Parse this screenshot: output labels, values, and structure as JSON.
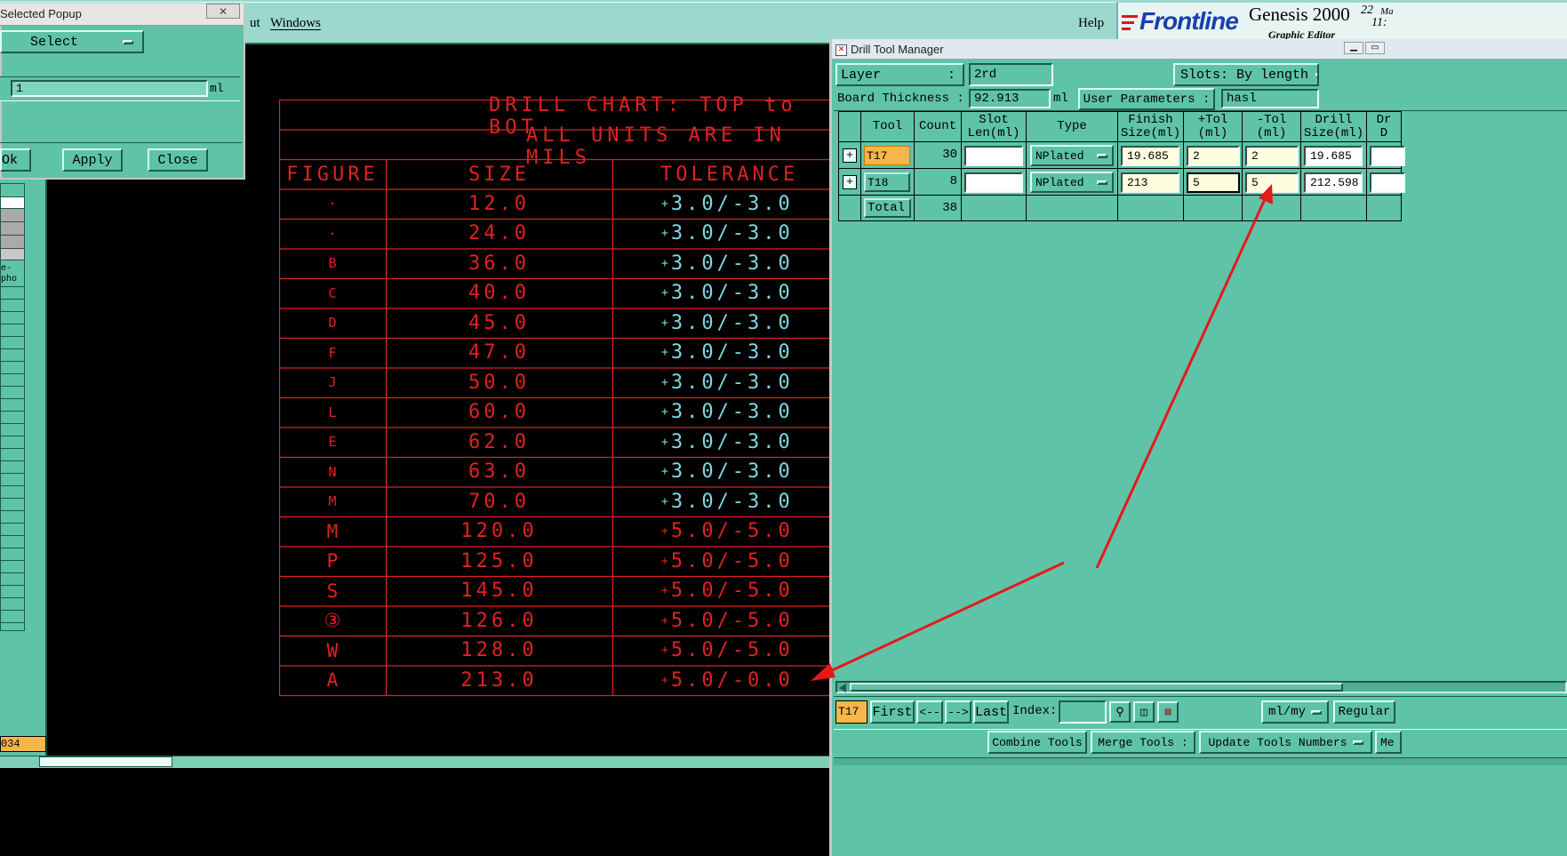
{
  "topbar": {
    "menu_out": "ut",
    "menu_windows": "Windows",
    "help": "Help",
    "brand": "Frontline",
    "product": "Genesis 2000",
    "product_sub": "Graphic Editor",
    "date_frag": "22",
    "date_month_frag": "Ma",
    "time_frag": "11:"
  },
  "popup": {
    "title": "Selected Popup",
    "mode": "Select",
    "value": "1",
    "unit": "ml",
    "ok": "Ok",
    "apply": "Apply",
    "close": "Close"
  },
  "left_panel": {
    "label_frag": "e-pho",
    "bottom_value": "034"
  },
  "drill_chart": {
    "title": "DRILL CHART: TOP to BOT",
    "subtitle": "ALL UNITS ARE IN MILS",
    "headers": [
      "FIGURE",
      "SIZE",
      "TOLERANCE"
    ],
    "rows": [
      {
        "figure": "·",
        "size": "12.0",
        "tol_sign": "+",
        "tol": "3.0/-3.0"
      },
      {
        "figure": "·",
        "size": "24.0",
        "tol_sign": "+",
        "tol": "3.0/-3.0"
      },
      {
        "figure": "B",
        "size": "36.0",
        "tol_sign": "+",
        "tol": "3.0/-3.0"
      },
      {
        "figure": "C",
        "size": "40.0",
        "tol_sign": "+",
        "tol": "3.0/-3.0"
      },
      {
        "figure": "D",
        "size": "45.0",
        "tol_sign": "+",
        "tol": "3.0/-3.0"
      },
      {
        "figure": "F",
        "size": "47.0",
        "tol_sign": "+",
        "tol": "3.0/-3.0"
      },
      {
        "figure": "J",
        "size": "50.0",
        "tol_sign": "+",
        "tol": "3.0/-3.0"
      },
      {
        "figure": "L",
        "size": "60.0",
        "tol_sign": "+",
        "tol": "3.0/-3.0"
      },
      {
        "figure": "E",
        "size": "62.0",
        "tol_sign": "+",
        "tol": "3.0/-3.0"
      },
      {
        "figure": "N",
        "size": "63.0",
        "tol_sign": "+",
        "tol": "3.0/-3.0"
      },
      {
        "figure": "M",
        "size": "70.0",
        "tol_sign": "+",
        "tol": "3.0/-3.0"
      },
      {
        "figure": "M",
        "size": "120.0",
        "tol_sign": "+",
        "tol": "5.0/-5.0"
      },
      {
        "figure": "P",
        "size": "125.0",
        "tol_sign": "+",
        "tol": "5.0/-5.0"
      },
      {
        "figure": "S",
        "size": "145.0",
        "tol_sign": "+",
        "tol": "5.0/-5.0"
      },
      {
        "figure": "③",
        "size": "126.0",
        "tol_sign": "+",
        "tol": "5.0/-5.0"
      },
      {
        "figure": "W",
        "size": "128.0",
        "tol_sign": "+",
        "tol": "5.0/-5.0"
      },
      {
        "figure": "A",
        "size": "213.0",
        "tol_sign": "+",
        "tol": "5.0/-0.0"
      }
    ]
  },
  "dtm": {
    "title": "Drill Tool Manager",
    "layer_label": "Layer",
    "layer_colon": ":",
    "layer_value": "2rd",
    "slots_label": "Slots:",
    "slots_value": "By length",
    "thickness_label": "Board Thickness :",
    "thickness_value": "92.913",
    "thickness_unit": "ml",
    "user_params_label": "User Parameters :",
    "user_params_value": "hasl",
    "columns": [
      "Tool",
      "Count",
      "Slot Len(ml)",
      "Type",
      "Finish Size(ml)",
      "+Tol (ml)",
      "-Tol (ml)",
      "Drill Size(ml)",
      "Dr D"
    ],
    "rows": [
      {
        "tool": "T17",
        "count": "30",
        "slot_len": "",
        "type": "NPlated",
        "finish": "19.685",
        "ptol": "2",
        "mtol": "2",
        "drill": "19.685"
      },
      {
        "tool": "T18",
        "count": "8",
        "slot_len": "",
        "type": "NPlated",
        "finish": "213",
        "ptol": "5",
        "mtol": "5",
        "drill": "212.598"
      }
    ],
    "total_label": "Total",
    "total_count": "38",
    "nav": {
      "current": "T17",
      "first": "First",
      "prev": "<--",
      "next": "-->",
      "last": "Last",
      "index_label": "Index:",
      "index_value": "",
      "units": "ml/my",
      "mode": "Regular"
    },
    "actions": {
      "combine": "Combine Tools",
      "merge": "Merge Tools :",
      "update": "Update Tools Numbers",
      "more": "Me"
    }
  },
  "colors": {
    "app_bg": "#5fc3a8",
    "topbar_bg": "#9cd8ce",
    "chart_line": "#e02222",
    "chart_tol": "#7fd8e0",
    "highlight": "#f7b64a",
    "field_bg": "#fffde0",
    "annotation_arrow": "#e81818"
  }
}
